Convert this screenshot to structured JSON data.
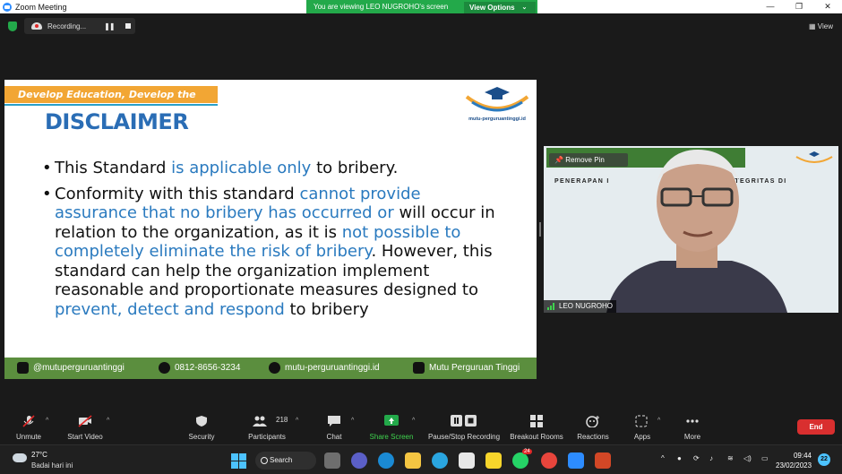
{
  "window": {
    "title": "Zoom Meeting",
    "viewing_banner": "You are viewing LEO NUGROHO's screen",
    "view_options": "View Options"
  },
  "topstrip": {
    "recording_label": "Recording...",
    "view_label": "View"
  },
  "slide": {
    "tagline": "Develop Education, Develop the Nation",
    "logo_text": "mutu-perguruantinggi.id",
    "heading": "DISCLAIMER",
    "bullets": [
      {
        "parts": [
          {
            "text": "This Standard ",
            "hl": false
          },
          {
            "text": "is applicable only",
            "hl": true
          },
          {
            "text": " to bribery.",
            "hl": false
          }
        ]
      },
      {
        "parts": [
          {
            "text": "Conformity with this standard ",
            "hl": false
          },
          {
            "text": "cannot provide assurance that no bribery has occurred or",
            "hl": true
          },
          {
            "text": " will occur in relation to the organization, as it is ",
            "hl": false
          },
          {
            "text": "not possible to completely eliminate the risk of bribery",
            "hl": true
          },
          {
            "text": ". However, this standard can help the organization implement reasonable and proportionate measures designed to ",
            "hl": false
          },
          {
            "text": "prevent, detect and respond",
            "hl": true
          },
          {
            "text": " to bribery",
            "hl": false
          }
        ]
      }
    ],
    "footer": {
      "instagram": "@mutuperguruantinggi",
      "whatsapp": "0812-8656-3234",
      "website": "mutu-perguruantinggi.id",
      "youtube": "Mutu Perguruan Tinggi"
    }
  },
  "video": {
    "remove_pin": "Remove Pin",
    "banner_left": "PENERAPAN I",
    "banner_right": "NA INTEGRITAS DI",
    "name": "LEO NUGROHO"
  },
  "toolbar": {
    "unmute": "Unmute",
    "start_video": "Start Video",
    "security": "Security",
    "participants": "Participants",
    "participants_count": "218",
    "chat": "Chat",
    "share_screen": "Share Screen",
    "record": "Pause/Stop Recording",
    "breakout": "Breakout Rooms",
    "reactions": "Reactions",
    "apps": "Apps",
    "more": "More",
    "end": "End"
  },
  "taskbar": {
    "temp": "27°C",
    "weather_desc": "Badai hari ini",
    "search": "Search",
    "time": "09:44",
    "date": "23/02/2023",
    "notifications": "22",
    "whatsapp_badge": "24",
    "colors": {
      "accent": "#4cc2ff"
    }
  }
}
